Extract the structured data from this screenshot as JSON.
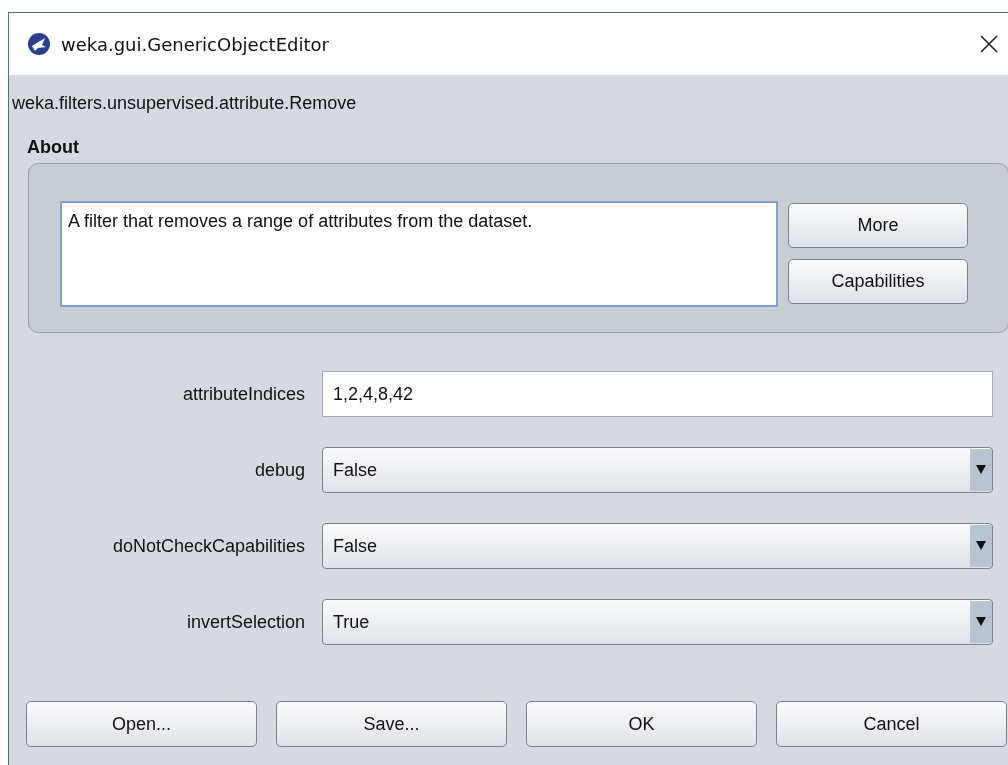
{
  "window": {
    "title": "weka.gui.GenericObjectEditor"
  },
  "class_name": "weka.filters.unsupervised.attribute.Remove",
  "about": {
    "heading": "About",
    "text": "A filter that removes a range of attributes from the dataset.",
    "buttons": [
      "More",
      "Capabilities"
    ]
  },
  "properties": [
    {
      "label": "attributeIndices",
      "kind": "text",
      "value": "1,2,4,8,42"
    },
    {
      "label": "debug",
      "kind": "choice",
      "value": "False"
    },
    {
      "label": "doNotCheckCapabilities",
      "kind": "choice",
      "value": "False"
    },
    {
      "label": "invertSelection",
      "kind": "choice",
      "value": "True"
    }
  ],
  "buttons": [
    "Open...",
    "Save...",
    "OK",
    "Cancel"
  ]
}
